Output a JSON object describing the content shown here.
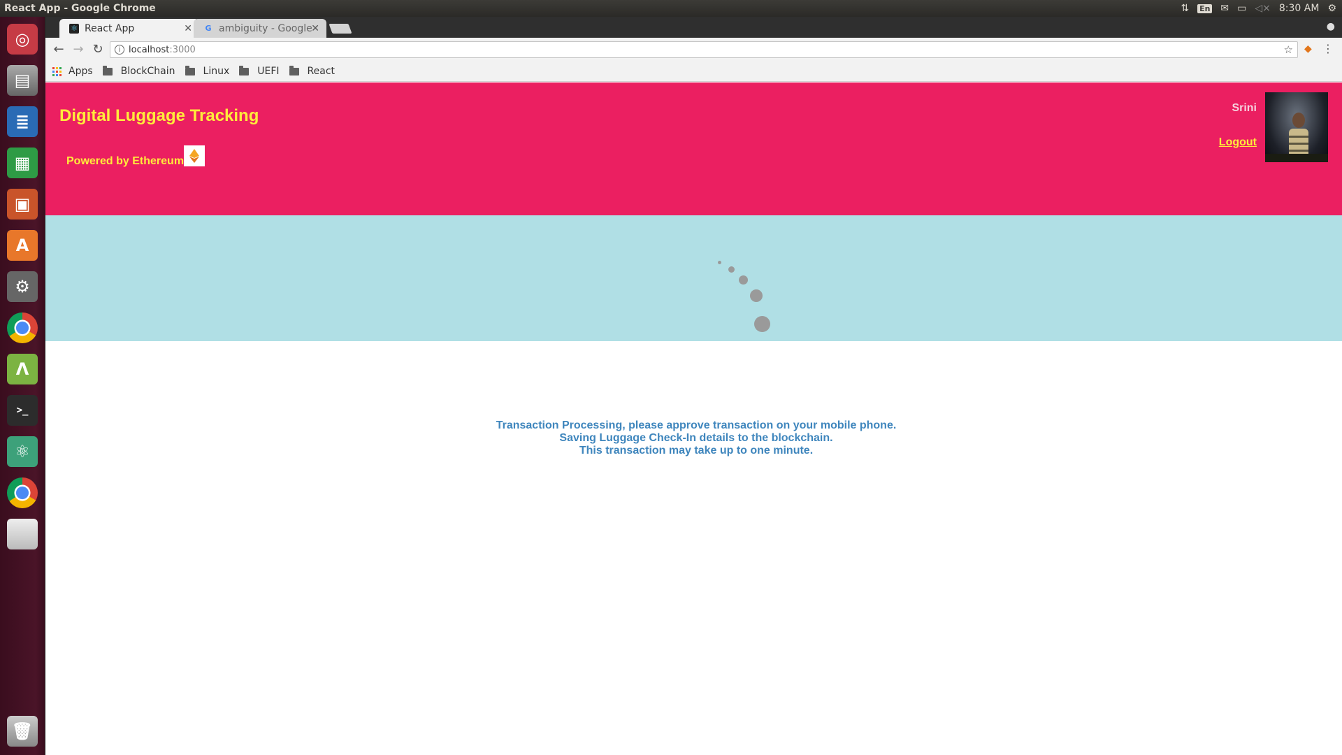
{
  "os": {
    "window_title": "React App - Google Chrome",
    "tray": {
      "network_icon": "network-updown-icon",
      "keyboard_lang": "En",
      "mail_icon": "mail-icon",
      "battery_icon": "battery-icon",
      "volume_icon": "volume-muted-icon",
      "clock": "8:30 AM",
      "settings_icon": "gear-icon"
    },
    "launcher": [
      "ubuntu-dash",
      "files",
      "writer",
      "calc",
      "impress",
      "software-center",
      "system-settings",
      "chrome",
      "android-studio",
      "terminal",
      "atom",
      "chrome-running",
      "removable-drive",
      "trash"
    ]
  },
  "browser": {
    "tabs": [
      {
        "label": "React App",
        "active": true
      },
      {
        "label": "ambiguity - Google",
        "active": false
      }
    ],
    "url_host": "localhost",
    "url_port": ":3000",
    "bookmarks": {
      "apps": "Apps",
      "folders": [
        "BlockChain",
        "Linux",
        "UEFI",
        "React"
      ]
    }
  },
  "app": {
    "title": "Digital Luggage Tracking",
    "powered_by": "Powered by Ethereum",
    "user_name": "Srini",
    "logout_label": "Logout",
    "colors": {
      "header": "#eb1f61",
      "accent_text": "#ffeb3b",
      "loader_band": "#b0dfe5",
      "status_text": "#3f86bd"
    },
    "status_lines": [
      "Transaction Processing, please approve transaction on your mobile phone.",
      "Saving Luggage Check-In details to the blockchain.",
      "This transaction may take up to one minute."
    ]
  }
}
